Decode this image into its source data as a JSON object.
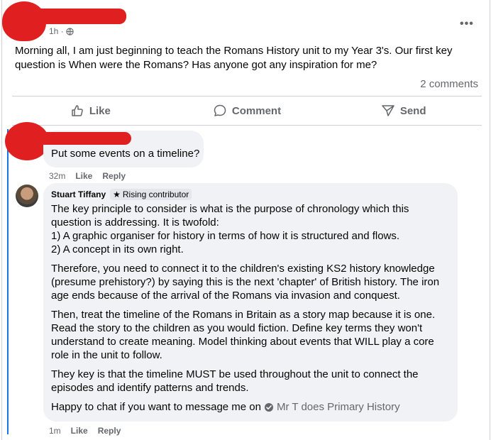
{
  "post": {
    "time": "1h ·",
    "text": "Morning all, I am just beginning to teach the Romans History unit to my Year 3's. Our first key question is When were the Romans? Has anyone got any inspiration for me?",
    "more_label": "•••",
    "comments_count": "2 comments"
  },
  "actions": {
    "like": "Like",
    "comment": "Comment",
    "send": "Send"
  },
  "comments": [
    {
      "text": "Put some events on a timeline?",
      "time": "32m",
      "like": "Like",
      "reply": "Reply"
    },
    {
      "author": "Stuart Tiffany",
      "badge": "Rising contributor",
      "paragraphs": [
        [
          "The key principle to consider is what is the purpose of chronology which this",
          "question is addressing. It is twofold:",
          "1) A graphic organiser for history in terms of how it is structured and flows.",
          "2) A concept in its own right."
        ],
        [
          "Therefore, you need to connect it to the children's existing KS2 history knowledge",
          "(presume prehistory?) by saying this is the next 'chapter' of British history. The iron",
          "age ends because of the arrival of the Romans via invasion and conquest."
        ],
        [
          "Then, treat the timeline of the Romans in Britain as a story map because it is one.",
          "Read the story to the children as you would fiction. Define key terms they won't",
          "understand to create meaning. Model thinking about events that WILL play a core",
          "role in the unit to follow."
        ],
        [
          "They key is that the timeline MUST be used throughout the unit to connect the",
          "episodes and identify patterns and trends."
        ]
      ],
      "closing": "Happy to chat if you want to message me on",
      "page_link": "Mr T does Primary History",
      "time": "1m",
      "like": "Like",
      "reply": "Reply"
    }
  ],
  "colors": {
    "redaction": "#e02020",
    "thread_line": "#1b74e4",
    "bubble": "#f0f2f5",
    "muted": "#65676b"
  }
}
